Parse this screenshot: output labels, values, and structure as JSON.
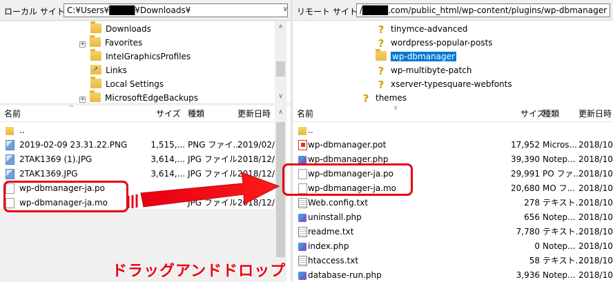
{
  "local": {
    "site_label": "ローカル サイト:",
    "site_path": "C:¥Users¥████¥Downloads¥",
    "tree": [
      {
        "label": "Downloads",
        "icon": "download-folder-icon"
      },
      {
        "label": "Favorites",
        "icon": "folder-icon",
        "expander": "+"
      },
      {
        "label": "IntelGraphicsProfiles",
        "icon": "folder-icon"
      },
      {
        "label": "Links",
        "icon": "links-folder-icon"
      },
      {
        "label": "Local Settings",
        "icon": "folder-icon"
      },
      {
        "label": "MicrosoftEdgeBackups",
        "icon": "folder-icon",
        "expander": "+"
      }
    ],
    "columns": {
      "name": "名前",
      "size": "サイズ",
      "type": "種類",
      "date": "更新日時"
    },
    "files": [
      {
        "name": "..",
        "size": "",
        "type": "",
        "date": "",
        "icon": "folder-icon"
      },
      {
        "name": "2019-02-09 23.31.22.PNG",
        "size": "1,515,...",
        "type": "PNG ファイ...",
        "date": "2019/02/",
        "icon": "image-file-icon"
      },
      {
        "name": "2TAK1369 (1).JPG",
        "size": "3,614,...",
        "type": "JPG ファイル",
        "date": "2018/12/",
        "icon": "image-file-icon"
      },
      {
        "name": "2TAK1369.JPG",
        "size": "3,614,...",
        "type": "JPG ファイル",
        "date": "2018/12/",
        "icon": "image-file-icon"
      },
      {
        "name": "wp-dbmanager-ja.po",
        "size": "",
        "type": "",
        "date": "",
        "icon": "document-file-icon"
      },
      {
        "name": "wp-dbmanager-ja.mo",
        "size": "",
        "type": "JPG ファイル",
        "date": "2018/12/",
        "icon": "document-file-icon"
      }
    ]
  },
  "remote": {
    "site_label": "リモート サイト:",
    "site_path": "/████.com/public_html/wp-content/plugins/wp-dbmanager",
    "tree": [
      {
        "label": "tinymce-advanced",
        "icon": "unknown-folder-icon"
      },
      {
        "label": "wordpress-popular-posts",
        "icon": "unknown-folder-icon"
      },
      {
        "label": "wp-dbmanager",
        "icon": "folder-icon",
        "selected": true
      },
      {
        "label": "wp-multibyte-patch",
        "icon": "unknown-folder-icon"
      },
      {
        "label": "xserver-typesquare-webfonts",
        "icon": "unknown-folder-icon"
      },
      {
        "label": "themes",
        "icon": "unknown-folder-icon"
      }
    ],
    "columns": {
      "name": "名前",
      "size": "サイズ",
      "type": "種類",
      "date": "更新日時"
    },
    "files": [
      {
        "name": "..",
        "size": "",
        "type": "",
        "date": "",
        "icon": "folder-icon"
      },
      {
        "name": "wp-dbmanager.pot",
        "size": "17,952",
        "type": "Micros...",
        "date": "2018/10",
        "icon": "pot-file-icon"
      },
      {
        "name": "wp-dbmanager.php",
        "size": "39,390",
        "type": "Notep...",
        "date": "2018/10",
        "icon": "php-file-icon"
      },
      {
        "name": "wp-dbmanager-ja.po",
        "size": "29,991",
        "type": "PO ファ...",
        "date": "2018/10",
        "icon": "document-file-icon"
      },
      {
        "name": "wp-dbmanager-ja.mo",
        "size": "20,680",
        "type": "MO フ...",
        "date": "2018/10",
        "icon": "document-file-icon"
      },
      {
        "name": "Web.config.txt",
        "size": "278",
        "type": "テキスト...",
        "date": "2018/10",
        "icon": "text-file-icon"
      },
      {
        "name": "uninstall.php",
        "size": "656",
        "type": "Notep...",
        "date": "2018/10",
        "icon": "php-file-icon"
      },
      {
        "name": "readme.txt",
        "size": "7,780",
        "type": "テキスト...",
        "date": "2018/10",
        "icon": "text-file-icon"
      },
      {
        "name": "index.php",
        "size": "0",
        "type": "Notep...",
        "date": "2018/10",
        "icon": "php-file-icon"
      },
      {
        "name": "htaccess.txt",
        "size": "58",
        "type": "テキスト...",
        "date": "2018/10",
        "icon": "text-file-icon"
      },
      {
        "name": "database-run.php",
        "size": "3,936",
        "type": "Notep...",
        "date": "2018/10",
        "icon": "php-file-icon"
      }
    ]
  },
  "annotation": {
    "caption": "ドラッグアンドドロップ",
    "accent_color": "#e60012"
  }
}
